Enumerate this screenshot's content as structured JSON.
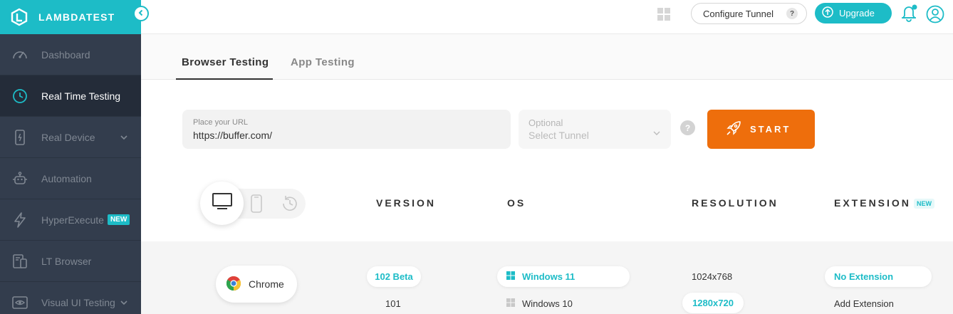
{
  "brand": {
    "name": "LAMBDATEST"
  },
  "sidebar": {
    "items": [
      {
        "label": "Dashboard"
      },
      {
        "label": "Real Time Testing"
      },
      {
        "label": "Real Device"
      },
      {
        "label": "Automation"
      },
      {
        "label": "HyperExecute",
        "badge": "NEW"
      },
      {
        "label": "LT Browser"
      },
      {
        "label": "Visual UI Testing"
      }
    ]
  },
  "topbar": {
    "tunnel_label": "Configure Tunnel",
    "tunnel_help": "?",
    "upgrade_label": "Upgrade"
  },
  "tabs": [
    {
      "label": "Browser Testing"
    },
    {
      "label": "App Testing"
    }
  ],
  "form": {
    "url_placeholder": "Place your URL",
    "url_value": "https://buffer.com/",
    "tunnel_optional": "Optional",
    "tunnel_placeholder": "Select Tunnel",
    "help": "?",
    "start_label": "START"
  },
  "columns": {
    "version": "VERSION",
    "os": "OS",
    "resolution": "RESOLUTION",
    "extension": "EXTENSION",
    "extension_badge": "NEW"
  },
  "selection": {
    "browser": "Chrome",
    "versions": [
      "102 Beta",
      "101"
    ],
    "os_list": [
      "Windows 11",
      "Windows 10"
    ],
    "resolutions": [
      "1024x768",
      "1280x720"
    ],
    "extensions": [
      "No Extension",
      "Add Extension"
    ]
  },
  "colors": {
    "accent": "#1dbcc7",
    "start": "#ee6e0c",
    "sidebar": "#333d4d"
  }
}
